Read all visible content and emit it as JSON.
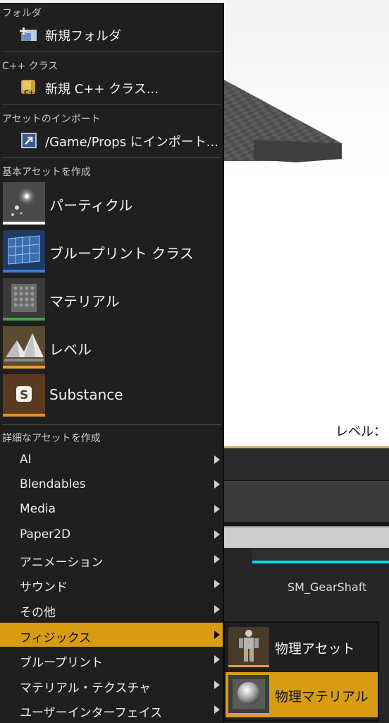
{
  "viewport": {
    "level_label": "レベル："
  },
  "content_browser": {
    "asset_name": "SM_GearShaft"
  },
  "menu": {
    "folder_section": "フォルダ",
    "new_folder": "新規フォルダ",
    "cpp_section": "C++ クラス",
    "new_cpp_class": "新規 C++ クラス...",
    "import_section": "アセットのインポート",
    "import_item": "/Game/Props にインポート...",
    "basic_section": "基本アセットを作成",
    "basic_assets": [
      {
        "label": "パーティクル",
        "icon": "particle-icon",
        "color": "#ffffff"
      },
      {
        "label": "ブループリント クラス",
        "icon": "blueprint-icon",
        "color": "#3a7fe0"
      },
      {
        "label": "マテリアル",
        "icon": "material-icon",
        "color": "#3fa83a"
      },
      {
        "label": "レベル",
        "icon": "level-icon",
        "color": "#f0a020"
      },
      {
        "label": "Substance",
        "icon": "substance-icon",
        "color": "#f0901a"
      }
    ],
    "advanced_section": "詳細なアセットを作成",
    "advanced_items": [
      {
        "label": "AI"
      },
      {
        "label": "Blendables"
      },
      {
        "label": "Media"
      },
      {
        "label": "Paper2D"
      },
      {
        "label": "アニメーション"
      },
      {
        "label": "サウンド"
      },
      {
        "label": "その他"
      },
      {
        "label": "フィジックス",
        "active": true
      },
      {
        "label": "ブループリント"
      },
      {
        "label": "マテリアル・テクスチャ"
      },
      {
        "label": "ユーザーインターフェイス"
      }
    ]
  },
  "submenu": {
    "items": [
      {
        "label": "物理アセット",
        "icon": "physics-asset-icon"
      },
      {
        "label": "物理マテリアル",
        "icon": "physical-material-icon",
        "active": true
      }
    ]
  },
  "colors": {
    "highlight": "#d89c12",
    "menu_bg": "#1f1f1f",
    "accent_cyan": "#14d4e6"
  }
}
